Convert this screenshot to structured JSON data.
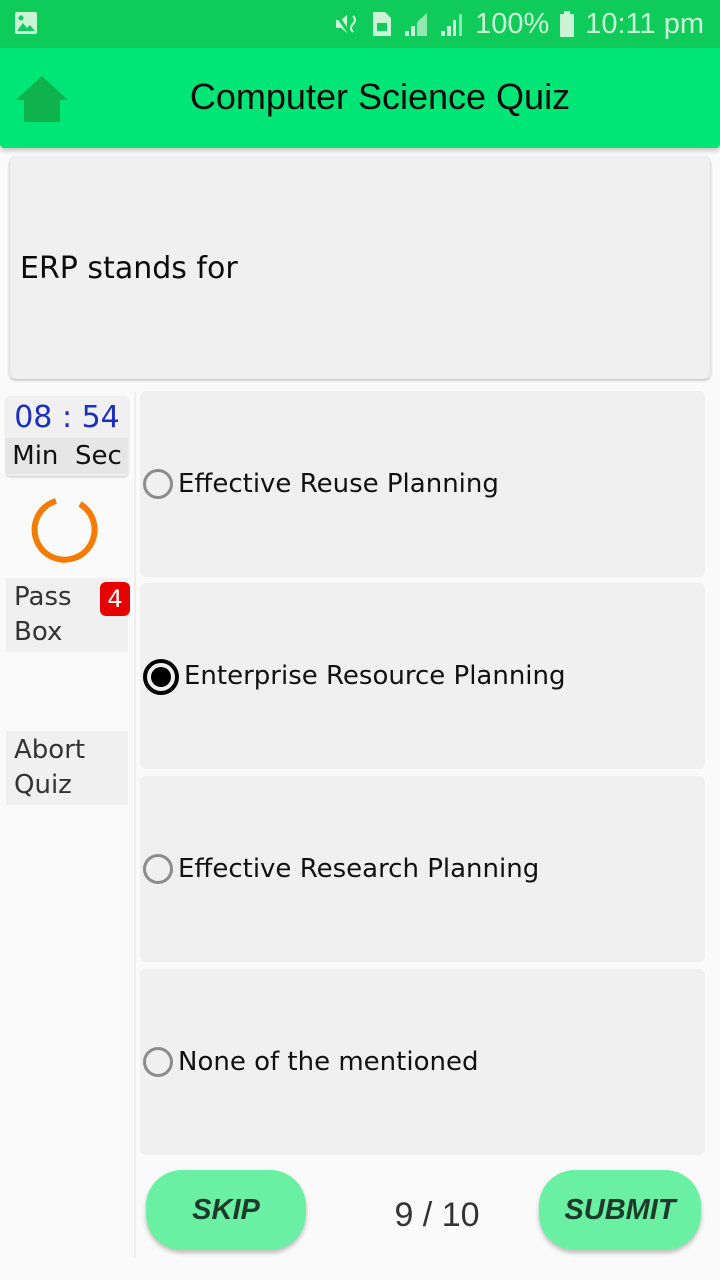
{
  "status_bar": {
    "left_icon": "gallery-icon",
    "icons": [
      "mute-vibrate-icon",
      "sim-icon",
      "signal-icon",
      "signal-icon"
    ],
    "battery": "100%",
    "time": "10:11 pm"
  },
  "app_bar": {
    "home_icon": "home-icon",
    "title": "Computer Science Quiz"
  },
  "question": {
    "text": "ERP stands for"
  },
  "sidebar": {
    "timer": {
      "minutes": "08",
      "separator": ":",
      "seconds": "54",
      "min_label": "Min",
      "sec_label": "Sec"
    },
    "pass_box": {
      "label_line1": "Pass",
      "label_line2": "Box",
      "count": "4"
    },
    "abort": {
      "label_line1": "Abort",
      "label_line2": "Quiz"
    }
  },
  "options": [
    {
      "label": "Effective Reuse Planning",
      "selected": false
    },
    {
      "label": "Enterprise Resource Planning",
      "selected": true
    },
    {
      "label": "Effective Research Planning",
      "selected": false
    },
    {
      "label": "None of the mentioned",
      "selected": false
    }
  ],
  "footer": {
    "skip_label": "SKIP",
    "submit_label": "SUBMIT",
    "progress": "9 / 10"
  },
  "colors": {
    "status_bar": "#0fcb5a",
    "app_bar": "#00e676",
    "button": "#69f0a3",
    "timer_text": "#1a2fc0",
    "spinner": "#f57c00",
    "badge": "#e60000"
  }
}
